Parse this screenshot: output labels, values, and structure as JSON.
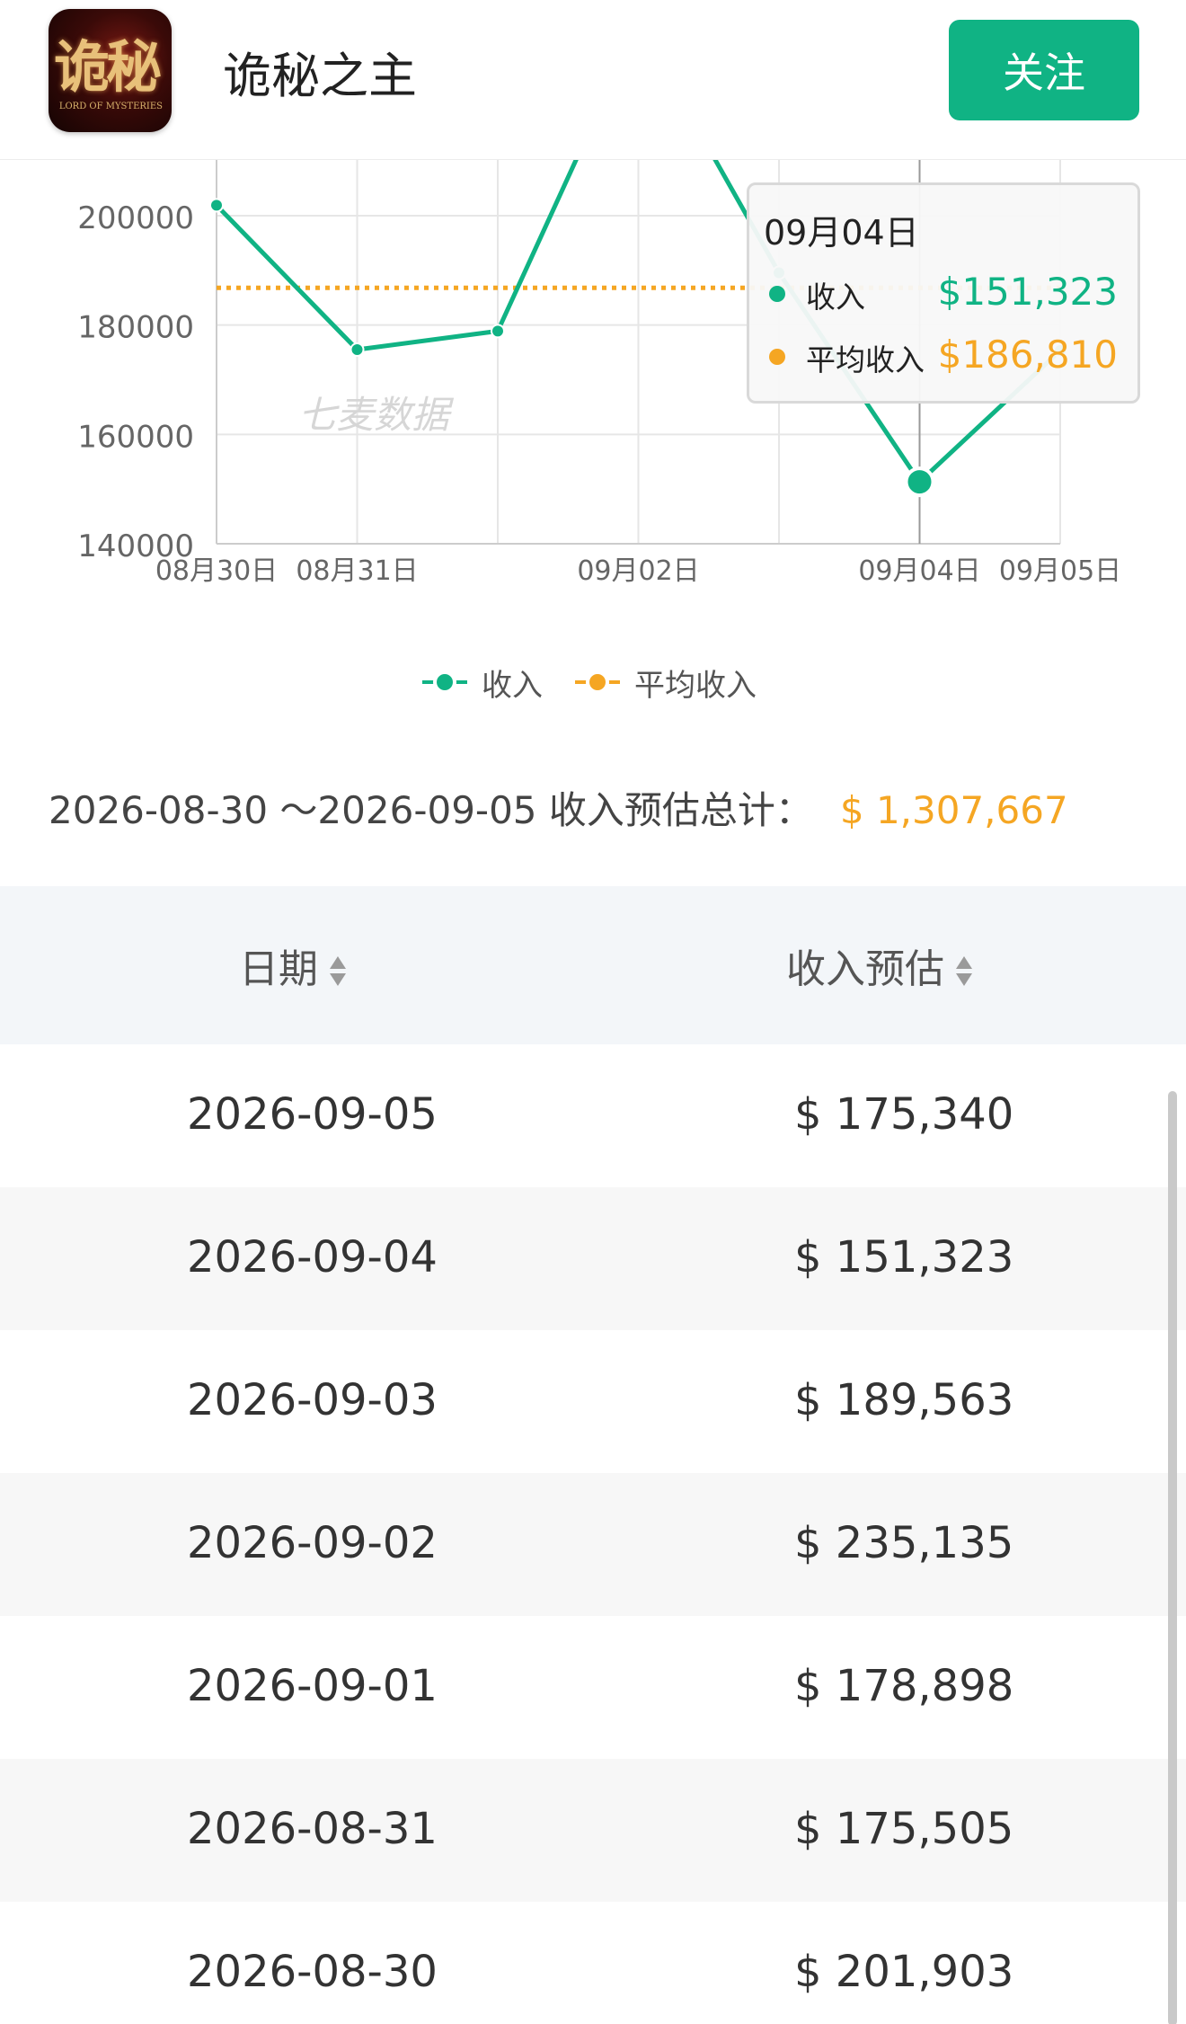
{
  "header": {
    "app_title": "诡秘之主",
    "follow_label": "关注",
    "icon_text": "诡秘",
    "icon_subtext": "LORD OF MYSTERIES"
  },
  "colors": {
    "income": "#10b384",
    "average": "#f5a623",
    "brand": "#10b384"
  },
  "watermark": "七麦数据",
  "chart_data": {
    "type": "line",
    "x": [
      "08月30日",
      "08月31日",
      "09月01日",
      "09月02日",
      "09月03日",
      "09月04日",
      "09月05日"
    ],
    "x_tick_labels": [
      "08月30日",
      "08月31日",
      "09月02日",
      "09月04日",
      "09月05日"
    ],
    "y_ticks": [
      140000,
      160000,
      180000,
      200000
    ],
    "ylim": [
      140000,
      200000
    ],
    "series": [
      {
        "name": "收入",
        "values": [
          201903,
          175505,
          178898,
          235135,
          189563,
          151323,
          175340
        ]
      },
      {
        "name": "平均收入",
        "values": [
          186810,
          186810,
          186810,
          186810,
          186810,
          186810,
          186810
        ]
      }
    ],
    "grid": true,
    "legend": "bottom",
    "tooltip": {
      "title": "09月04日",
      "rows": [
        {
          "label": "收入",
          "value": "$151,323"
        },
        {
          "label": "平均收入",
          "value": "$186,810"
        }
      ]
    }
  },
  "legend": [
    {
      "label": "收入"
    },
    {
      "label": "平均收入"
    }
  ],
  "summary": {
    "range": "2026-08-30 ～2026-09-05 收入预估总计：",
    "total": "$ 1,307,667"
  },
  "table": {
    "headers": [
      "日期",
      "收入预估"
    ],
    "rows": [
      {
        "date": "2026-09-05",
        "revenue": "$ 175,340"
      },
      {
        "date": "2026-09-04",
        "revenue": "$ 151,323"
      },
      {
        "date": "2026-09-03",
        "revenue": "$ 189,563"
      },
      {
        "date": "2026-09-02",
        "revenue": "$ 235,135"
      },
      {
        "date": "2026-09-01",
        "revenue": "$ 178,898"
      },
      {
        "date": "2026-08-31",
        "revenue": "$ 175,505"
      },
      {
        "date": "2026-08-30",
        "revenue": "$ 201,903"
      }
    ]
  }
}
